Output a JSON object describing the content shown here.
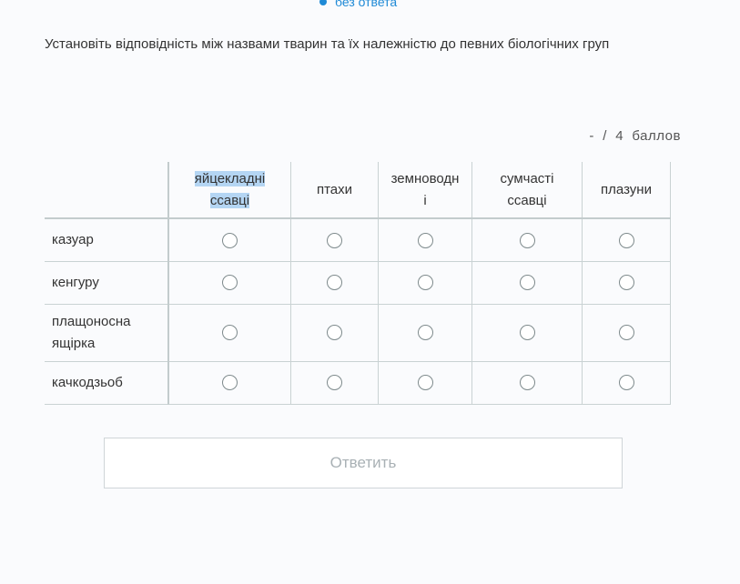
{
  "status": {
    "label": "без ответа",
    "color": "#1f8ad6"
  },
  "question": {
    "text": "Установіть відповідність між назвами тварин та їх належністю до певних біологічних груп"
  },
  "score": {
    "value": "-",
    "separator": "/",
    "max": "4",
    "unit": "баллов"
  },
  "matrix": {
    "columns": [
      {
        "lines": [
          "яйцекладні",
          "ссавці"
        ],
        "highlighted": true
      },
      {
        "lines": [
          "птахи"
        ]
      },
      {
        "lines": [
          "земноводн",
          "і"
        ]
      },
      {
        "lines": [
          "сумчасті",
          "ссавці"
        ]
      },
      {
        "lines": [
          "плазуни"
        ]
      }
    ],
    "rows": [
      {
        "lines": [
          "казуар"
        ]
      },
      {
        "lines": [
          "кенгуру"
        ]
      },
      {
        "lines": [
          "плащоносна",
          "ящірка"
        ]
      },
      {
        "lines": [
          "качкодзьоб"
        ]
      }
    ]
  },
  "submit": {
    "label": "Ответить"
  }
}
